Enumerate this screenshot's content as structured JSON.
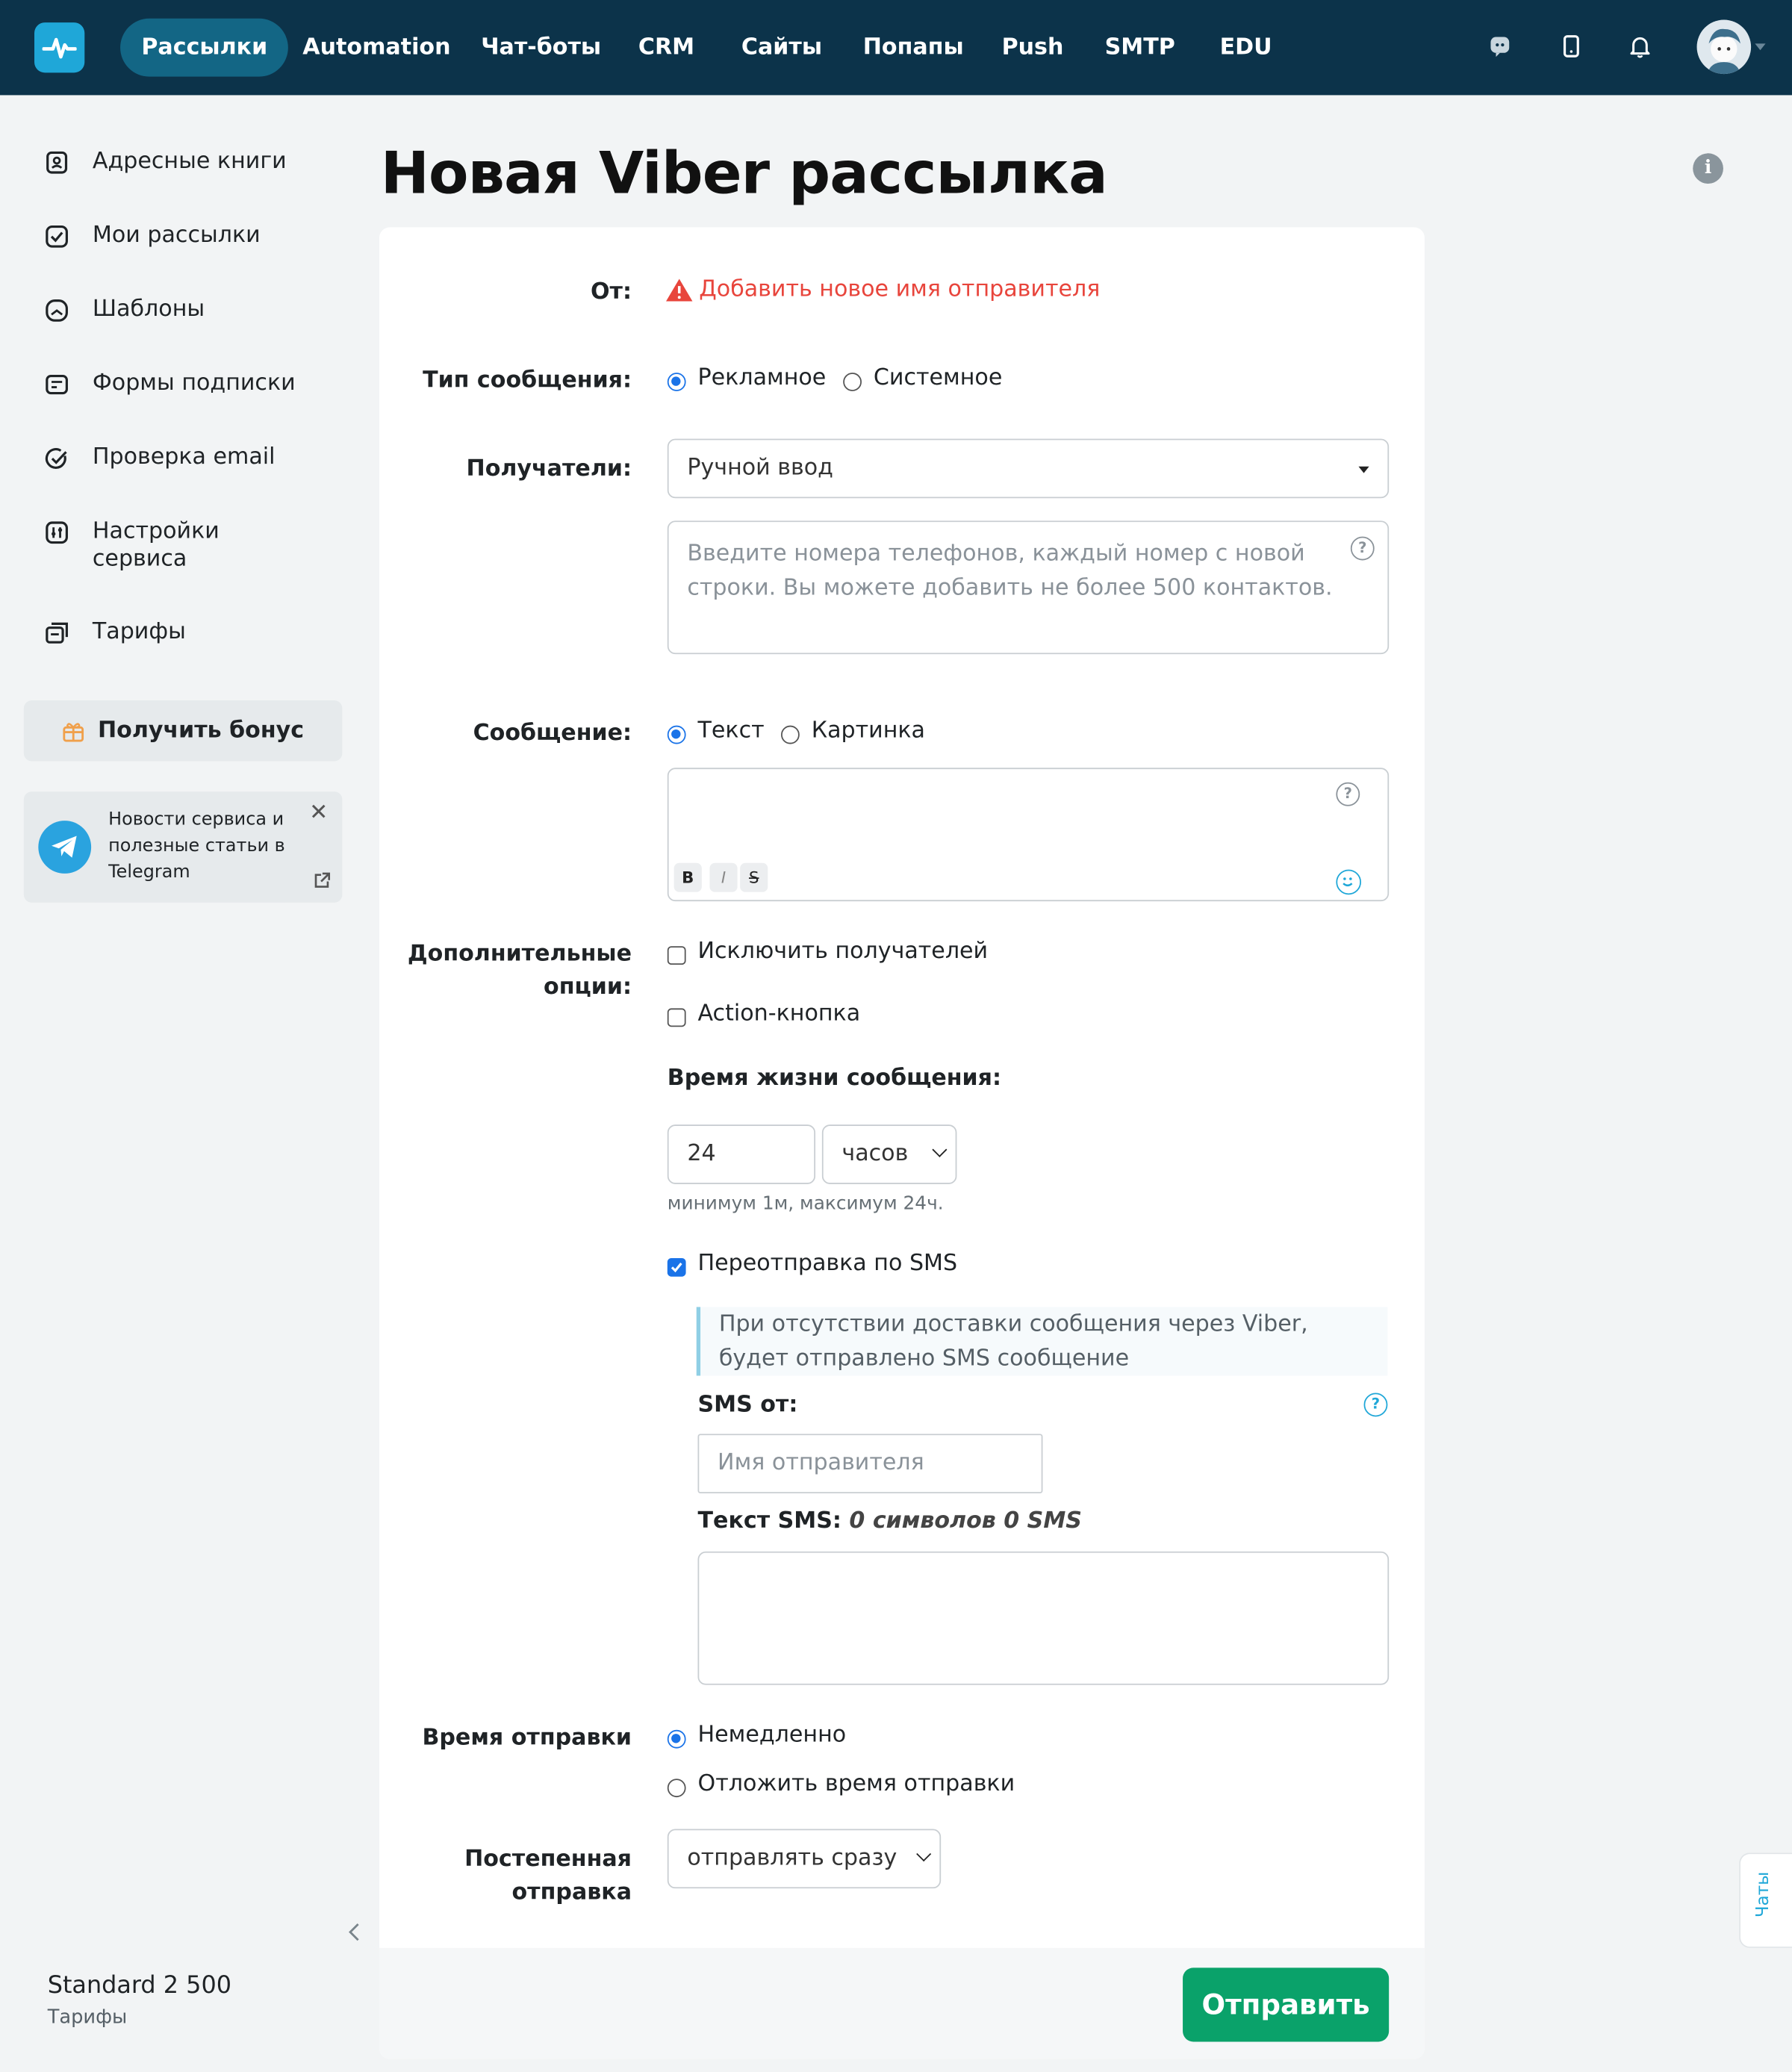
{
  "topnav": {
    "items": [
      "Рассылки",
      "Automation",
      "Чат-боты",
      "CRM",
      "Сайты",
      "Попапы",
      "Push",
      "SMTP",
      "EDU"
    ],
    "active": "Рассылки"
  },
  "sidebar": {
    "items": [
      {
        "label": "Адресные книги",
        "icon": "address-book-icon"
      },
      {
        "label": "Мои рассылки",
        "icon": "campaigns-icon"
      },
      {
        "label": "Шаблоны",
        "icon": "templates-icon"
      },
      {
        "label": "Формы подписки",
        "icon": "forms-icon"
      },
      {
        "label": "Проверка email",
        "icon": "email-check-icon"
      },
      {
        "label": "Настройки сервиса",
        "icon": "settings-icon"
      },
      {
        "label": "Тарифы",
        "icon": "tariffs-icon"
      }
    ],
    "bonus_label": "Получить бонус",
    "telegram_text": "Новости сервиса и полезные статьи в Telegram",
    "plan_name": "Standard 2 500",
    "plan_link": "Тарифы"
  },
  "page": {
    "title": "Новая Viber рассылка"
  },
  "form": {
    "from_label": "От:",
    "from_warning": "Добавить новое имя отправителя",
    "type_label": "Тип сообщения:",
    "type_options": [
      "Рекламное",
      "Системное"
    ],
    "recipients_label": "Получатели:",
    "recipients_value": "Ручной ввод",
    "phones_placeholder": "Введите номера телефонов, каждый номер с новой строки. Вы можете добавить не более 500 контактов.",
    "message_label": "Сообщение:",
    "message_options": [
      "Текст",
      "Картинка"
    ],
    "format_buttons": [
      "B",
      "I",
      "S"
    ],
    "extra_label": "Дополнительные опции:",
    "exclude_label": "Исключить получателей",
    "action_label": "Action-кнопка",
    "ttl_label": "Время жизни сообщения:",
    "ttl_value": "24",
    "ttl_unit": "часов",
    "ttl_hint": "минимум 1м, максимум 24ч.",
    "resend_label": "Переотправка по SMS",
    "resend_note": "При отсутствии доставки сообщения через Viber, будет отправлено SMS сообщение",
    "sms_from_label": "SMS от:",
    "sms_from_placeholder": "Имя отправителя",
    "sms_text_label": "Текст SMS:",
    "sms_count": "0 символов 0 SMS",
    "send_time_label": "Время отправки",
    "send_time_options": [
      "Немедленно",
      "Отложить время отправки"
    ],
    "gradual_label": "Постепенная отправка",
    "gradual_value": "отправлять сразу",
    "submit_label": "Отправить"
  },
  "chats_tab": "Чаты",
  "colors": {
    "topbar": "#0c334a",
    "accent": "#1fa7d8",
    "submit": "#0aa26a",
    "warning": "#e8453c"
  }
}
